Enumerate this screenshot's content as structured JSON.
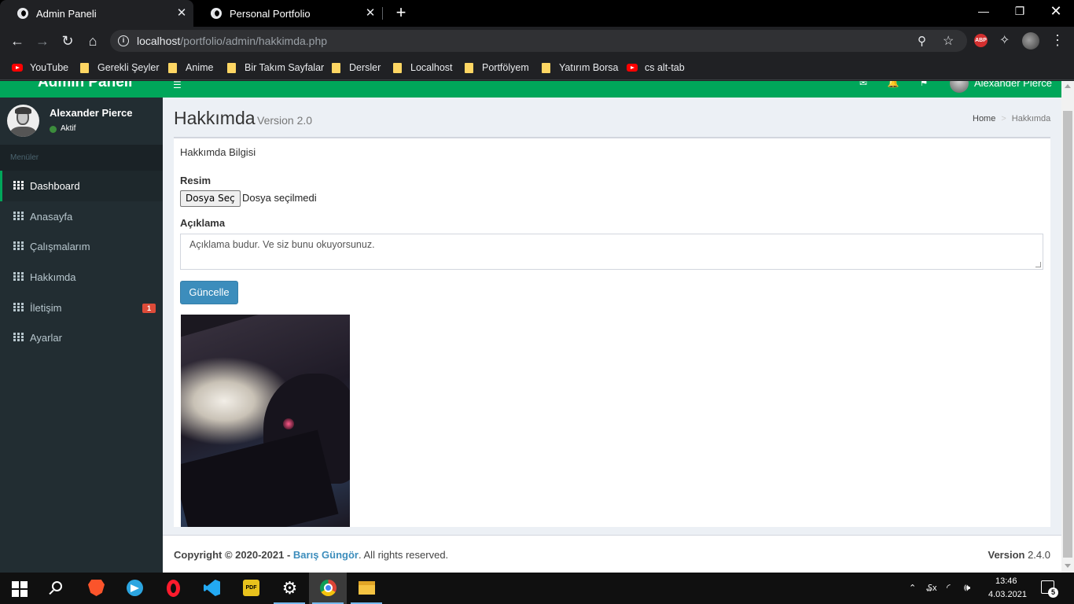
{
  "browser": {
    "tabs": [
      {
        "title": "Admin Paneli",
        "active": true
      },
      {
        "title": "Personal Portfolio",
        "active": false
      }
    ],
    "close_glyph": "✕",
    "new_tab_glyph": "+",
    "window_controls": {
      "minimize": "—",
      "maximize": "❐",
      "close": "✕"
    },
    "nav": {
      "back": "←",
      "forward": "→",
      "reload": "↻",
      "home": "⌂"
    },
    "url_host": "localhost",
    "url_path": "/portfolio/admin/hakkimda.php",
    "info_glyph": "i",
    "zoom_glyph": "⚲",
    "star_glyph": "☆",
    "extensions": {
      "abp_label": "ABP",
      "puzzle_glyph": "✧",
      "menu_glyph": "⋮"
    },
    "bookmarks": [
      {
        "label": "YouTube",
        "icon": "youtube"
      },
      {
        "label": "Gerekli Şeyler",
        "icon": "folder"
      },
      {
        "label": "Anime",
        "icon": "folder"
      },
      {
        "label": "Bir Takım Sayfalar",
        "icon": "folder"
      },
      {
        "label": "Dersler",
        "icon": "folder"
      },
      {
        "label": "Localhost",
        "icon": "folder"
      },
      {
        "label": "Portfölyem",
        "icon": "folder"
      },
      {
        "label": "Yatırım Borsa",
        "icon": "folder"
      },
      {
        "label": "cs alt-tab",
        "icon": "youtube"
      }
    ]
  },
  "topnav": {
    "logo": "Admin Paneli",
    "toggle_glyph": "☰",
    "mail_glyph": "✉",
    "bell_glyph": "🔔",
    "flag_glyph": "⚑",
    "user_name": "Alexander Pierce",
    "accent_color": "#00a65a"
  },
  "sidebar": {
    "user_name": "Alexander Pierce",
    "user_status": "Aktif",
    "menu_header": "Menüler",
    "items": [
      {
        "label": "Dashboard",
        "active": true
      },
      {
        "label": "Anasayfa"
      },
      {
        "label": "Çalışmalarım"
      },
      {
        "label": "Hakkımda"
      },
      {
        "label": "İletişim",
        "badge": "1"
      },
      {
        "label": "Ayarlar"
      }
    ]
  },
  "content": {
    "title": "Hakkımda",
    "subtitle": "Version 2.0",
    "breadcrumb": {
      "home": "Home",
      "separator": ">",
      "current": "Hakkımda"
    },
    "box_title": "Hakkımda Bilgisi",
    "image_label": "Resim",
    "file_button": "Dosya Seç",
    "file_status": "Dosya seçilmedi",
    "description_label": "Açıklama",
    "description_value": "Açıklama budur. Ve siz bunu okuyorsunuz.",
    "update_button": "Güncelle",
    "button_color": "#3c8dbc"
  },
  "footer": {
    "copyright": "Copyright © 2020-2021 -",
    "author": "Barış Güngör",
    "rights": ". All rights reserved.",
    "version_label": "Version",
    "version_value": "2.4.0"
  },
  "taskbar": {
    "apps": [
      "start",
      "search",
      "brave",
      "telegram",
      "opera",
      "vscode",
      "pdf",
      "settings",
      "chrome",
      "file-explorer"
    ],
    "pdf_label": "PDF",
    "settings_glyph": "⚙",
    "tray": {
      "up_glyph": "⌃",
      "lang": "₷x",
      "wifi_glyph": "◜",
      "volume_glyph": "🕪"
    },
    "time": "13:46",
    "date": "4.03.2021",
    "notification_count": "5"
  }
}
